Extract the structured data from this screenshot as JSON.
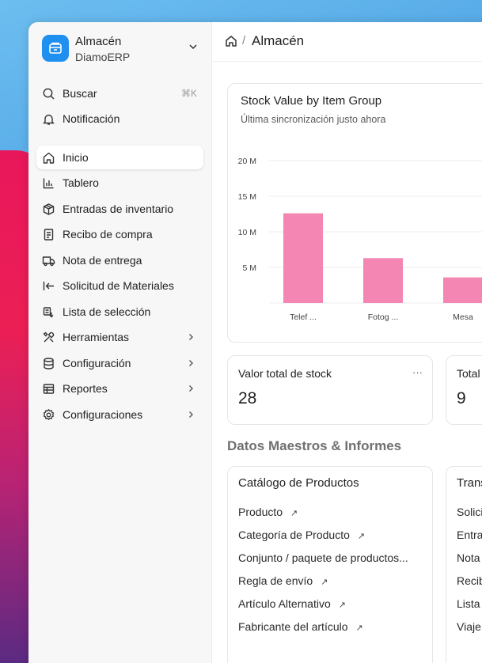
{
  "sidebar": {
    "brand": {
      "title": "Almacén",
      "subtitle": "DiamoERP"
    },
    "search": {
      "label": "Buscar",
      "shortcut": "⌘K"
    },
    "notification": {
      "label": "Notificación"
    },
    "items": [
      {
        "label": "Inicio",
        "icon": "home-icon",
        "active": true
      },
      {
        "label": "Tablero",
        "icon": "bar-chart-icon"
      },
      {
        "label": "Entradas de inventario",
        "icon": "box-icon"
      },
      {
        "label": "Recibo de compra",
        "icon": "receipt-icon"
      },
      {
        "label": "Nota de entrega",
        "icon": "truck-icon"
      },
      {
        "label": "Solicitud de Materiales",
        "icon": "arrow-left-bar-icon"
      },
      {
        "label": "Lista de selección",
        "icon": "list-icon"
      },
      {
        "label": "Herramientas",
        "icon": "tools-icon",
        "has_children": true
      },
      {
        "label": "Configuración",
        "icon": "database-icon",
        "has_children": true
      },
      {
        "label": "Reportes",
        "icon": "table-icon",
        "has_children": true
      },
      {
        "label": "Configuraciones",
        "icon": "gear-icon",
        "has_children": true
      }
    ]
  },
  "breadcrumb": {
    "current": "Almacén",
    "separator": "/"
  },
  "chart_card": {
    "title": "Stock Value by Item Group",
    "subtitle": "Última sincronización justo ahora"
  },
  "chart_data": {
    "type": "bar",
    "categories": [
      "Telef ...",
      "Fotog ...",
      "Mesa"
    ],
    "values": [
      12.6,
      6.3,
      3.6
    ],
    "y_ticks": [
      "5 M",
      "10 M",
      "15 M",
      "20 M"
    ],
    "ylim": [
      0,
      20
    ],
    "bar_color": "#f386b2",
    "grid": true
  },
  "number_cards": [
    {
      "title": "Valor total de stock",
      "value": "28",
      "menu": "···"
    },
    {
      "title": "Total",
      "value": "9"
    }
  ],
  "section_title": "Datos Maestros & Informes",
  "link_cards": [
    {
      "title": "Catálogo de Productos",
      "links": [
        {
          "label": "Producto",
          "arrow": "↗"
        },
        {
          "label": "Categoría de Producto",
          "arrow": "↗"
        },
        {
          "label": "Conjunto / paquete de productos...",
          "arrow": ""
        },
        {
          "label": "Regla de envío",
          "arrow": "↗"
        },
        {
          "label": "Artículo Alternativo",
          "arrow": "↗"
        },
        {
          "label": "Fabricante del artículo",
          "arrow": "↗"
        }
      ]
    },
    {
      "title": "Trans",
      "links": [
        {
          "label": "Solici"
        },
        {
          "label": "Entra"
        },
        {
          "label": "Nota"
        },
        {
          "label": "Recib"
        },
        {
          "label": "Lista"
        },
        {
          "label": "Viaje"
        }
      ]
    }
  ]
}
